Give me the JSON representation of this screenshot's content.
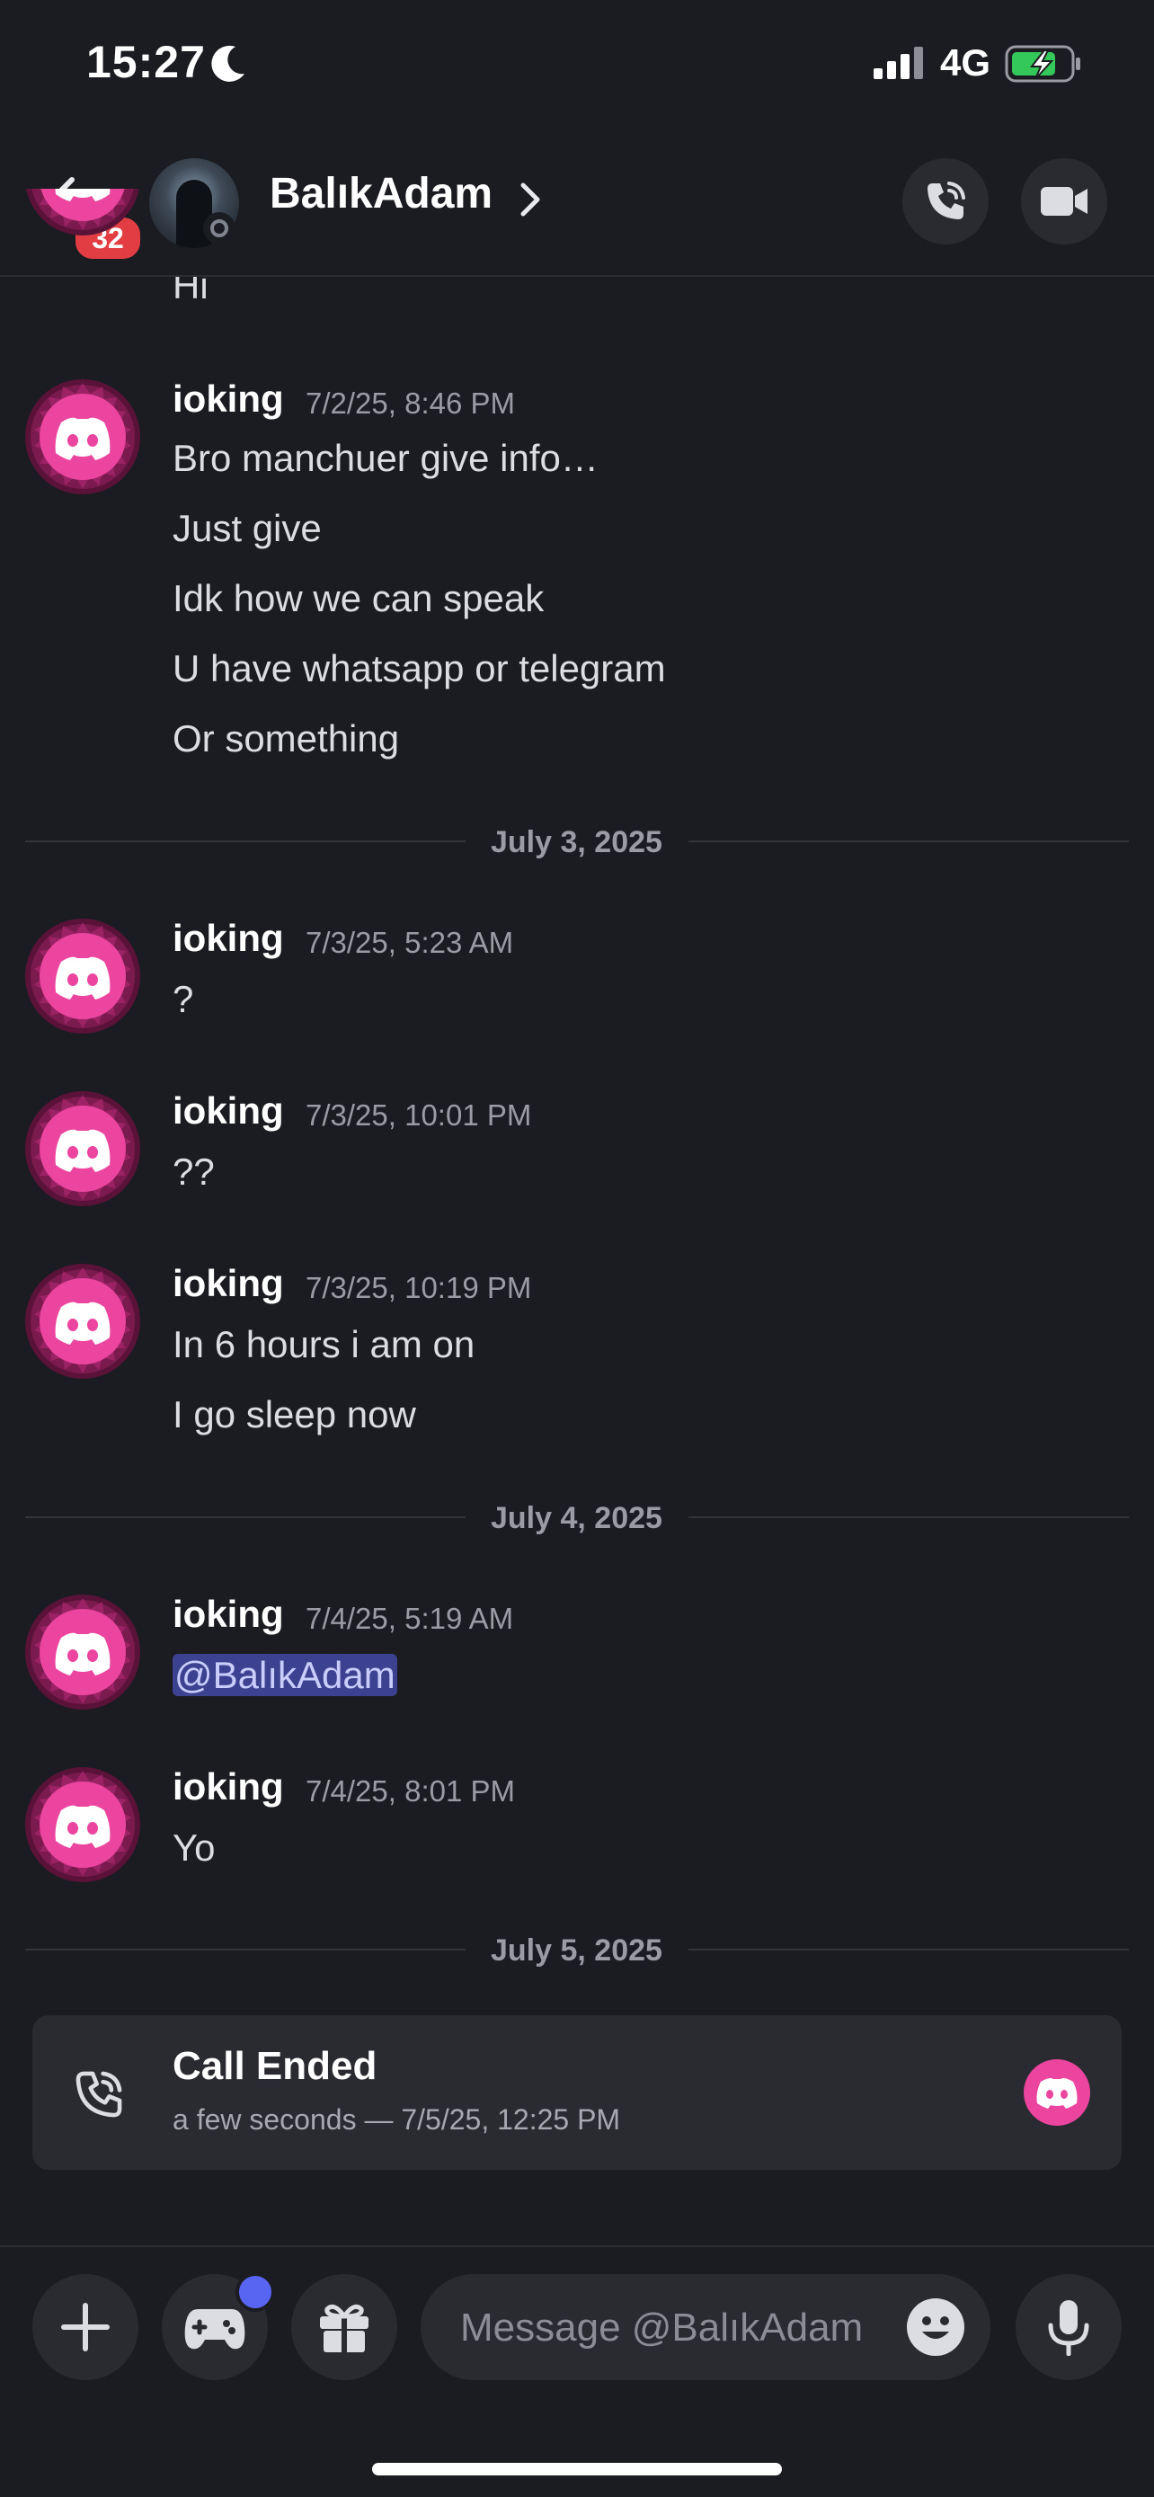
{
  "status_bar": {
    "time": "15:27",
    "network": "4G"
  },
  "header": {
    "back_badge": "32",
    "contact_name": "BalıkAdam"
  },
  "messages": {
    "partial": {
      "text": "Hi"
    },
    "groups": [
      {
        "user": "ioking",
        "time": "7/2/25, 8:46 PM",
        "lines": [
          "Bro manchuer give info…",
          "Just give",
          "Idk how we can speak",
          "U have whatsapp or telegram",
          "Or something"
        ]
      },
      {
        "user": "ioking",
        "time": "7/3/25, 5:23 AM",
        "lines": [
          "?"
        ]
      },
      {
        "user": "ioking",
        "time": "7/3/25, 10:01 PM",
        "lines": [
          "??"
        ]
      },
      {
        "user": "ioking",
        "time": "7/3/25, 10:19 PM",
        "lines": [
          "In 6 hours i am on",
          "I go sleep now"
        ]
      },
      {
        "user": "ioking",
        "time": "7/4/25, 5:19 AM",
        "mention": "@BalıkAdam"
      },
      {
        "user": "ioking",
        "time": "7/4/25, 8:01 PM",
        "lines": [
          "Yo"
        ]
      }
    ],
    "dividers": [
      "July 3, 2025",
      "July 4, 2025",
      "July 5, 2025"
    ]
  },
  "call_card": {
    "title": "Call Ended",
    "subtitle": "a few seconds — 7/5/25, 12:25 PM"
  },
  "composer": {
    "placeholder": "Message @BalıkAdam"
  },
  "colors": {
    "accent": "#5865f2",
    "avatar_pink": "#eb459f",
    "background": "#1b1c21",
    "surface": "#2a2b31",
    "mention_bg": "#3c4290"
  },
  "icons": [
    "moon-icon",
    "signal-icon",
    "battery-charging-icon",
    "back-arrow-icon",
    "chevron-right-icon",
    "phone-call-icon",
    "video-camera-icon",
    "discord-logo-icon",
    "plus-icon",
    "gamepad-icon",
    "gift-icon",
    "emoji-icon",
    "microphone-icon"
  ]
}
